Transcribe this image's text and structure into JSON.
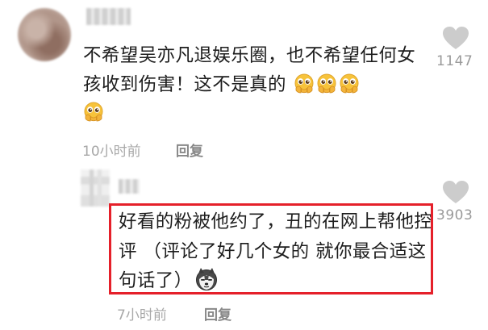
{
  "comment": {
    "text": "不希望吴亦凡退娱乐圈，也不希望任何女孩收到伤害！这不是真的",
    "emoji_count_inline": 3,
    "emoji_icon": "pleading-face-hands-icon",
    "time": "10小时前",
    "reply_label": "回复",
    "like_count": "1147",
    "like_icon": "heart-icon"
  },
  "reply": {
    "text": "好看的粉被他约了，丑的在网上帮他控评 （评论了好几个女的 就你最合适这句话了）",
    "emoji_icon": "husky-dog-face-icon",
    "time": "7小时前",
    "reply_label": "回复",
    "like_count": "3903",
    "like_icon": "heart-icon"
  },
  "colors": {
    "highlight_border": "#e5202a",
    "meta_text": "#a8a8a8",
    "like_icon": "#cccccc"
  }
}
